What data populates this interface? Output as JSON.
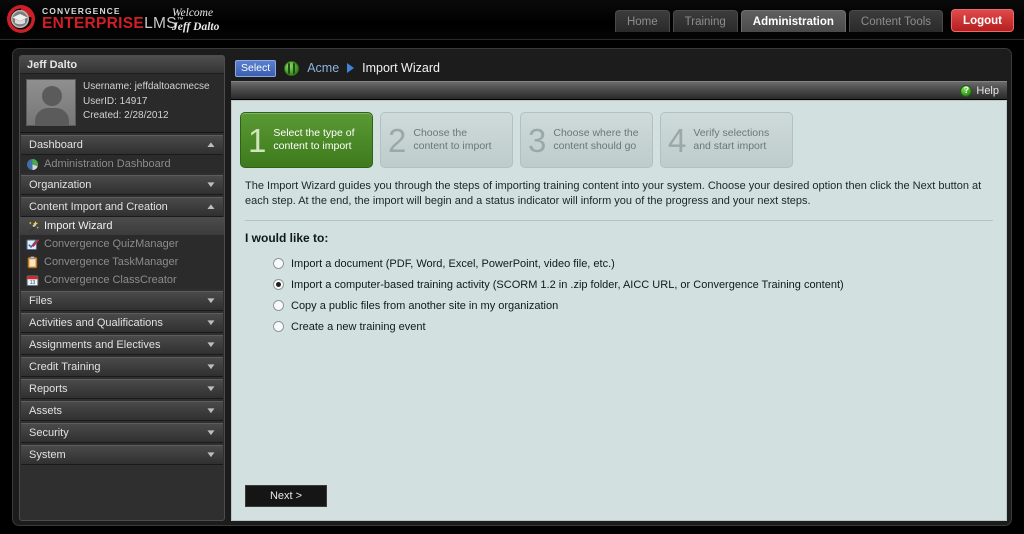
{
  "header": {
    "logo_line1": "CONVERGENCE",
    "logo_line2": "ENTERPRISE",
    "logo_lms": "LMS",
    "logo_tm": "™",
    "logo_icon": "graduation-cap-swoosh-logo",
    "welcome_line1": "Welcome",
    "welcome_line2": "Jeff Dalto",
    "nav": [
      {
        "label": "Home",
        "active": false
      },
      {
        "label": "Training",
        "active": false
      },
      {
        "label": "Administration",
        "active": true
      },
      {
        "label": "Content Tools",
        "active": false
      }
    ],
    "logout_label": "Logout"
  },
  "sidebar": {
    "panel_title": "Jeff Dalto",
    "avatar_icon": "user-placeholder-avatar",
    "user": {
      "username_line": "Username: jeffdaltoacmecse",
      "userid_line": "UserID: 14917",
      "created_line": "Created: 2/28/2012"
    },
    "groups": [
      {
        "label": "Dashboard",
        "chevron": "chevron-up-icon",
        "expanded": true,
        "items": [
          {
            "label": "Administration Dashboard",
            "icon": "pie-chart-icon",
            "active": false
          }
        ]
      },
      {
        "label": "Organization",
        "chevron": "chevron-down-icon",
        "expanded": false,
        "items": []
      },
      {
        "label": "Content Import and Creation",
        "chevron": "chevron-up-icon",
        "expanded": true,
        "items": [
          {
            "label": "Import Wizard",
            "icon": "magic-wand-icon",
            "active": true
          },
          {
            "label": "Convergence QuizManager",
            "icon": "quiz-checkbox-pen-icon",
            "active": false
          },
          {
            "label": "Convergence TaskManager",
            "icon": "clipboard-icon",
            "active": false
          },
          {
            "label": "Convergence ClassCreator",
            "icon": "calendar-icon",
            "active": false
          }
        ]
      },
      {
        "label": "Files",
        "chevron": "chevron-down-icon",
        "expanded": false,
        "items": []
      },
      {
        "label": "Activities and Qualifications",
        "chevron": "chevron-down-icon",
        "expanded": false,
        "items": []
      },
      {
        "label": "Assignments and Electives",
        "chevron": "chevron-down-icon",
        "expanded": false,
        "items": []
      },
      {
        "label": "Credit Training",
        "chevron": "chevron-down-icon",
        "expanded": false,
        "items": []
      },
      {
        "label": "Reports",
        "chevron": "chevron-down-icon",
        "expanded": false,
        "items": []
      },
      {
        "label": "Assets",
        "chevron": "chevron-down-icon",
        "expanded": false,
        "items": []
      },
      {
        "label": "Security",
        "chevron": "chevron-down-icon",
        "expanded": false,
        "items": []
      },
      {
        "label": "System",
        "chevron": "chevron-down-icon",
        "expanded": false,
        "items": []
      }
    ]
  },
  "breadcrumb": {
    "select_label": "Select",
    "org_icon": "green-globe-icon",
    "org_label": "Acme",
    "separator_icon": "triangle-right-icon",
    "current": "Import Wizard"
  },
  "helpbar": {
    "icon": "help-question-icon",
    "icon_glyph": "?",
    "label": "Help"
  },
  "wizard": {
    "steps": [
      {
        "number": "1",
        "line1": "Select the type of",
        "line2": "content to import",
        "active": true
      },
      {
        "number": "2",
        "line1": "Choose the",
        "line2": "content to import",
        "active": false
      },
      {
        "number": "3",
        "line1": "Choose where the",
        "line2": "content should go",
        "active": false
      },
      {
        "number": "4",
        "line1": "Verify selections",
        "line2": "and start import",
        "active": false
      }
    ],
    "intro": "The Import Wizard guides you through the steps of importing training content into your system. Choose your desired option then click the Next button at each step. At the end, the import will begin and a status indicator will inform you of the progress and your next steps.",
    "prompt": "I would like to:",
    "options": [
      {
        "label": "Import a document (PDF, Word, Excel, PowerPoint, video file, etc.)",
        "selected": false
      },
      {
        "label": "Import a computer-based training activity (SCORM 1.2 in .zip folder, AICC URL, or Convergence Training content)",
        "selected": true
      },
      {
        "label": "Copy a public files from another site in my organization",
        "selected": false
      },
      {
        "label": "Create a new training event",
        "selected": false
      }
    ],
    "next_label": "Next >"
  },
  "colors": {
    "brand_red": "#d21f26",
    "accent_green": "#4a8a2a",
    "panel_bg": "#d2e0e0",
    "link_blue": "#8ab4dd"
  }
}
